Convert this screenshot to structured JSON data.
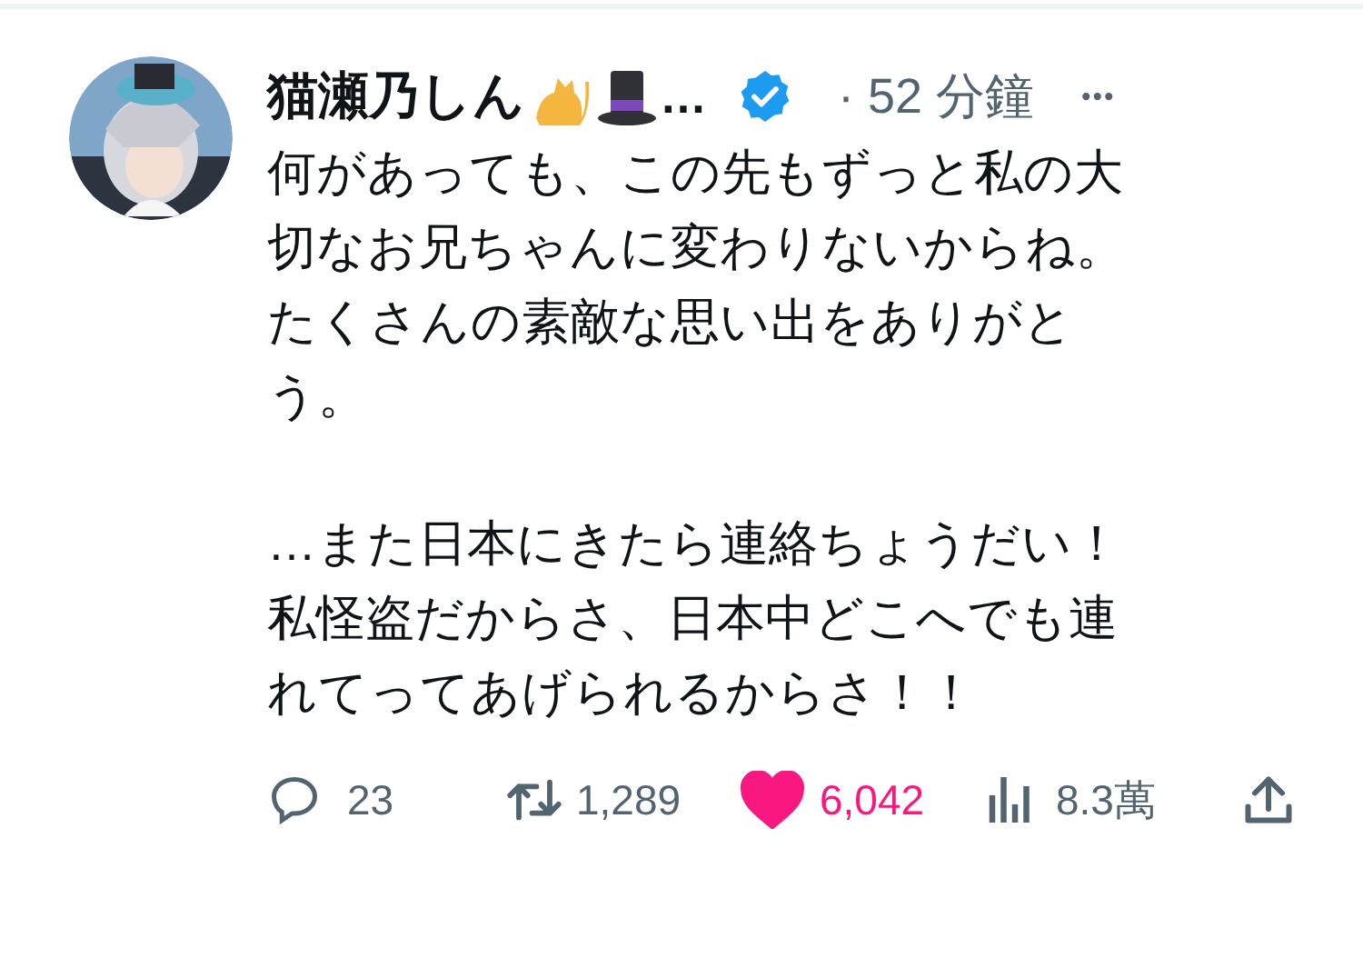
{
  "author": {
    "name": "猫瀬乃しん",
    "ellipsis": "…",
    "verified": true,
    "time": "· 52 分鐘",
    "more": "•••"
  },
  "body": [
    {
      "lines": [
        "何があっても、この先もずっと私の大",
        "切なお兄ちゃんに変わりないからね。",
        "たくさんの素敵な思い出をありがと",
        "う。"
      ]
    },
    {
      "lines": [
        "…また日本にきたら連絡ちょうだい！",
        "私怪盗だからさ、日本中どこへでも連",
        "れてってあげられるからさ！！"
      ]
    }
  ],
  "actions": [
    {
      "kind": "reply",
      "count": "23"
    },
    {
      "kind": "retweet",
      "count": "1,289"
    },
    {
      "kind": "like",
      "count": "6,042",
      "selected": true
    },
    {
      "kind": "views",
      "count": "8.3萬"
    },
    {
      "kind": "share"
    }
  ]
}
